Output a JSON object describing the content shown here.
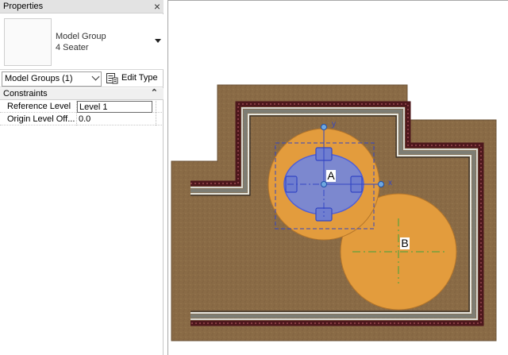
{
  "palette": {
    "title": "Properties",
    "close_glyph": "×",
    "type_selector": {
      "family": "Model Group",
      "type": "4 Seater"
    },
    "filter": {
      "selected": "Model Groups (1)"
    },
    "edit_type_label": "Edit Type",
    "sections": [
      {
        "label": "Constraints",
        "collapse_glyph": "⌃",
        "properties": [
          {
            "name": "Reference Level",
            "value": "Level 1"
          },
          {
            "name": "Origin Level Off...",
            "value": "0.0"
          }
        ]
      }
    ]
  },
  "canvas": {
    "group_a_label": "A",
    "group_b_label": "B",
    "axis_x_label": "x",
    "axis_y_label": "y",
    "colors": {
      "floor": "#8a6b46",
      "group_fill": "#e39c3d",
      "selection": "#4f5fd8",
      "wall_core": "#5a1d22",
      "wall_finish": "#8a8a80",
      "dashes": "#3da23d"
    }
  }
}
